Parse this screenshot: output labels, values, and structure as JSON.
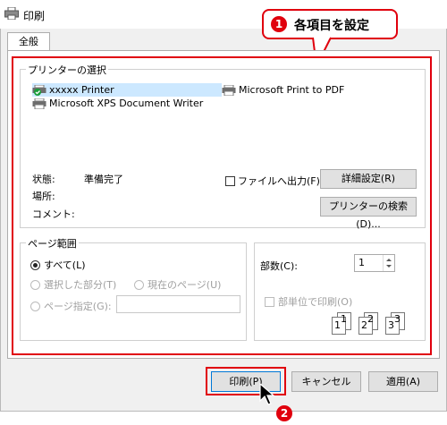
{
  "window": {
    "title": "印刷"
  },
  "tabs": [
    {
      "label": "全般"
    }
  ],
  "callout": {
    "number": "1",
    "text": "各項目を設定"
  },
  "printer_select": {
    "legend": "プリンターの選択",
    "printers": [
      {
        "name": "xxxxx Printer",
        "selected": true
      },
      {
        "name": "Microsoft Print to PDF",
        "selected": false
      },
      {
        "name": "Microsoft XPS Document Writer",
        "selected": false
      }
    ],
    "status_label": "状態:",
    "status_value": "準備完了",
    "location_label": "場所:",
    "comment_label": "コメント:",
    "print_to_file_label": "ファイルへ出力(F)",
    "details_button": "詳細設定(R)",
    "find_printer_button": "プリンターの検索(D)..."
  },
  "page_range": {
    "legend": "ページ範囲",
    "all_label": "すべて(L)",
    "selection_label": "選択した部分(T)",
    "current_page_label": "現在のページ(U)",
    "pages_label": "ページ指定(G):",
    "pages_value": ""
  },
  "copies": {
    "label": "部数(C):",
    "value": "1",
    "collate_label": "部単位で印刷(O)",
    "collate_page_numbers": [
      "1",
      "1",
      "2",
      "2",
      "3",
      "3"
    ]
  },
  "buttons": {
    "print": "印刷(P)",
    "cancel": "キャンセル",
    "apply": "適用(A)"
  },
  "step2": {
    "number": "2"
  },
  "colors": {
    "annotation_red": "#e0000d",
    "selection": "#cce8ff"
  }
}
